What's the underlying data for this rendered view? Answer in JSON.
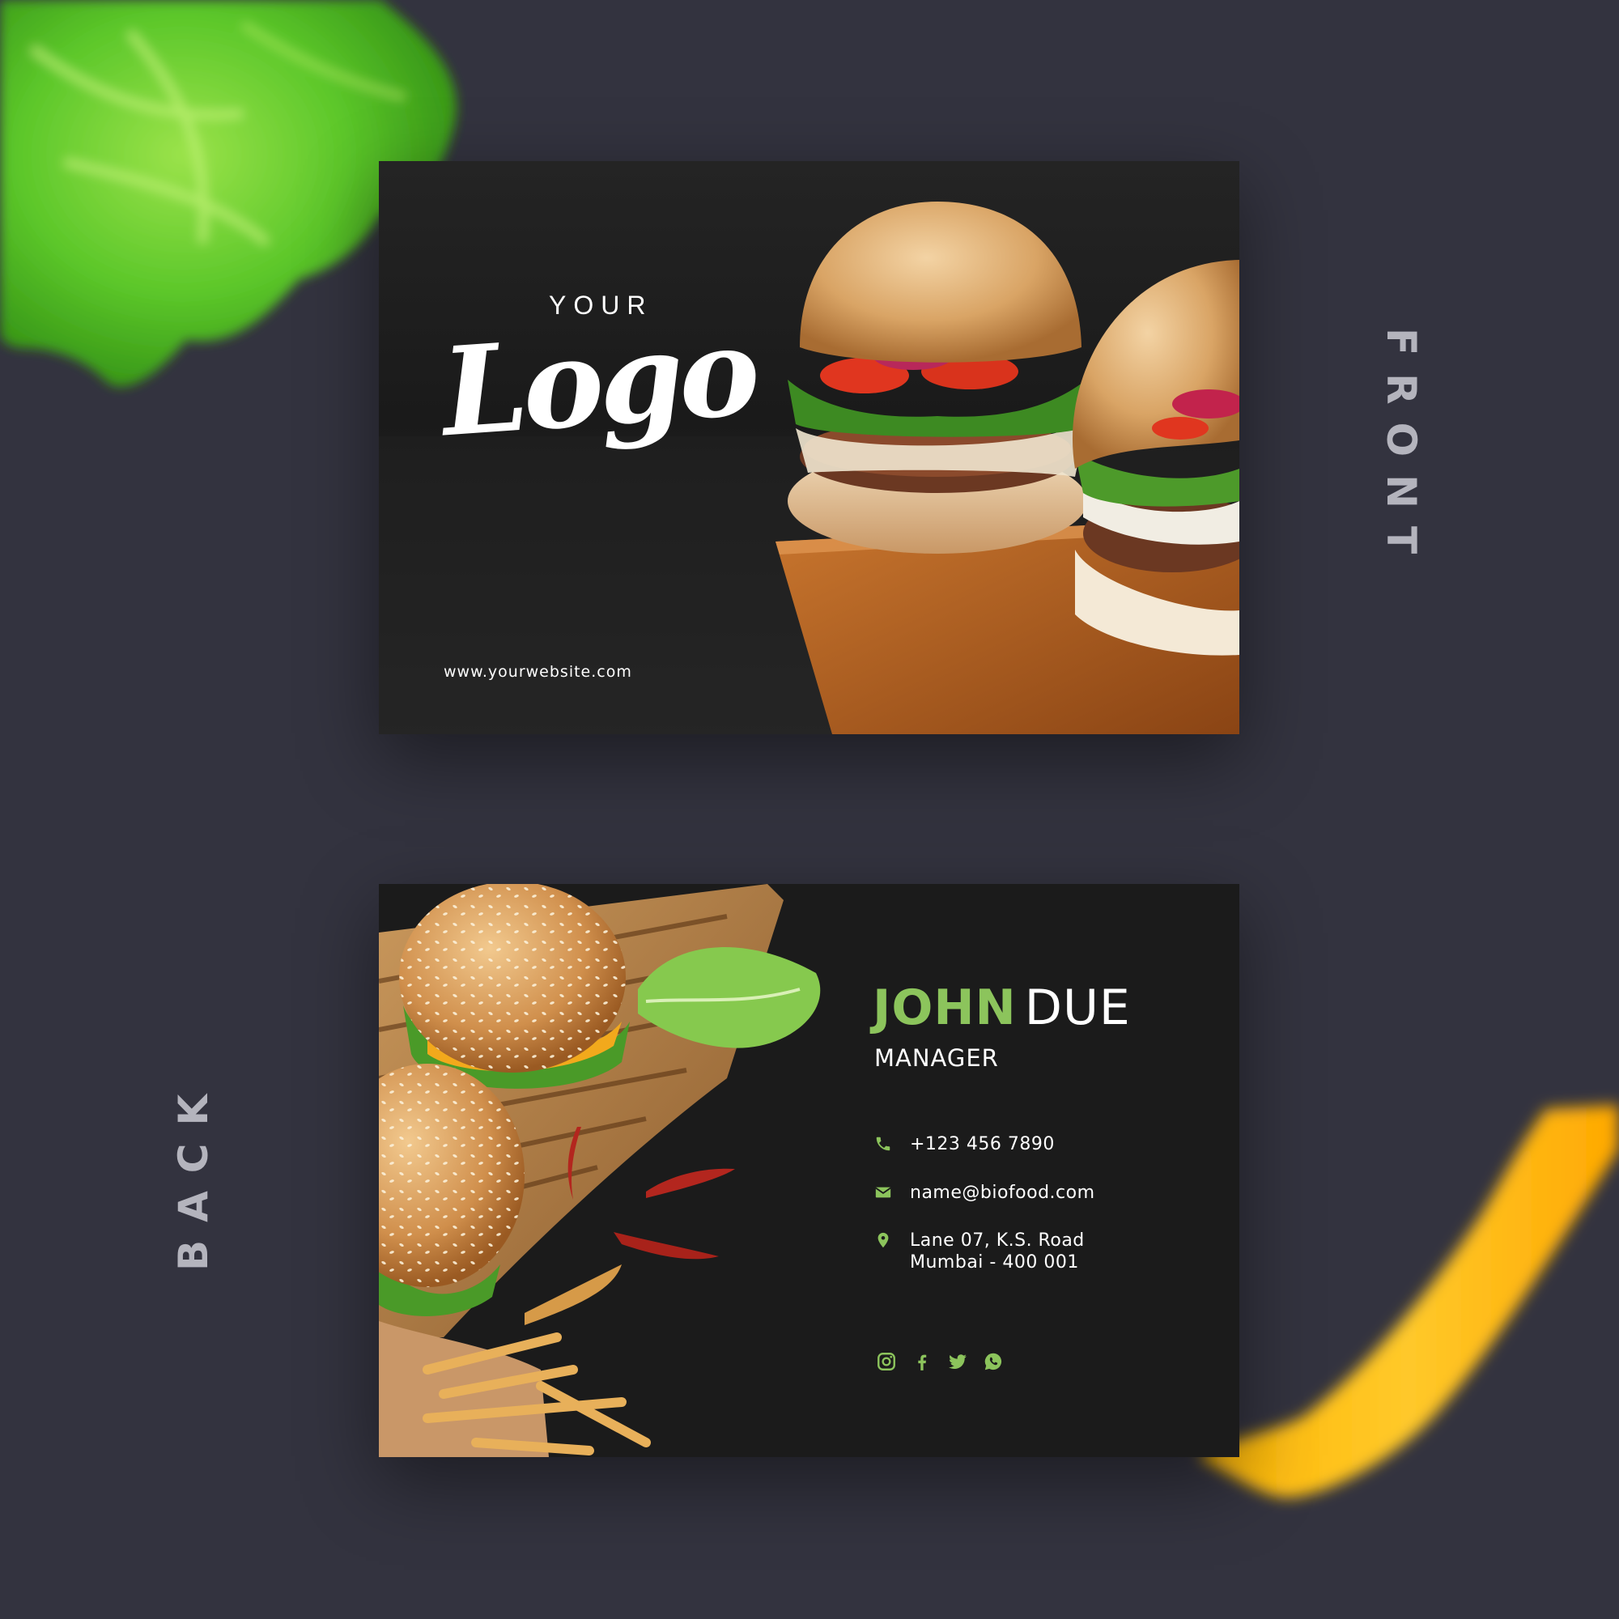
{
  "labels": {
    "front": "FRONT",
    "back": "BACK"
  },
  "front_card": {
    "logo_top": "YOUR",
    "logo_script": "Logo",
    "website": "www.yourwebsite.com"
  },
  "back_card": {
    "first_name": "JOHN",
    "last_name": "DUE",
    "title": "MANAGER",
    "phone": "+123 456 7890",
    "email": "name@biofood.com",
    "address_line1": "Lane 07, K.S. Road",
    "address_line2": "Mumbai - 400 001",
    "social_icons": [
      "instagram-icon",
      "facebook-icon",
      "twitter-icon",
      "whatsapp-icon"
    ]
  },
  "colors": {
    "background": "#33333f",
    "accent_green": "#8cc45c",
    "card": "#1a1a1a"
  }
}
